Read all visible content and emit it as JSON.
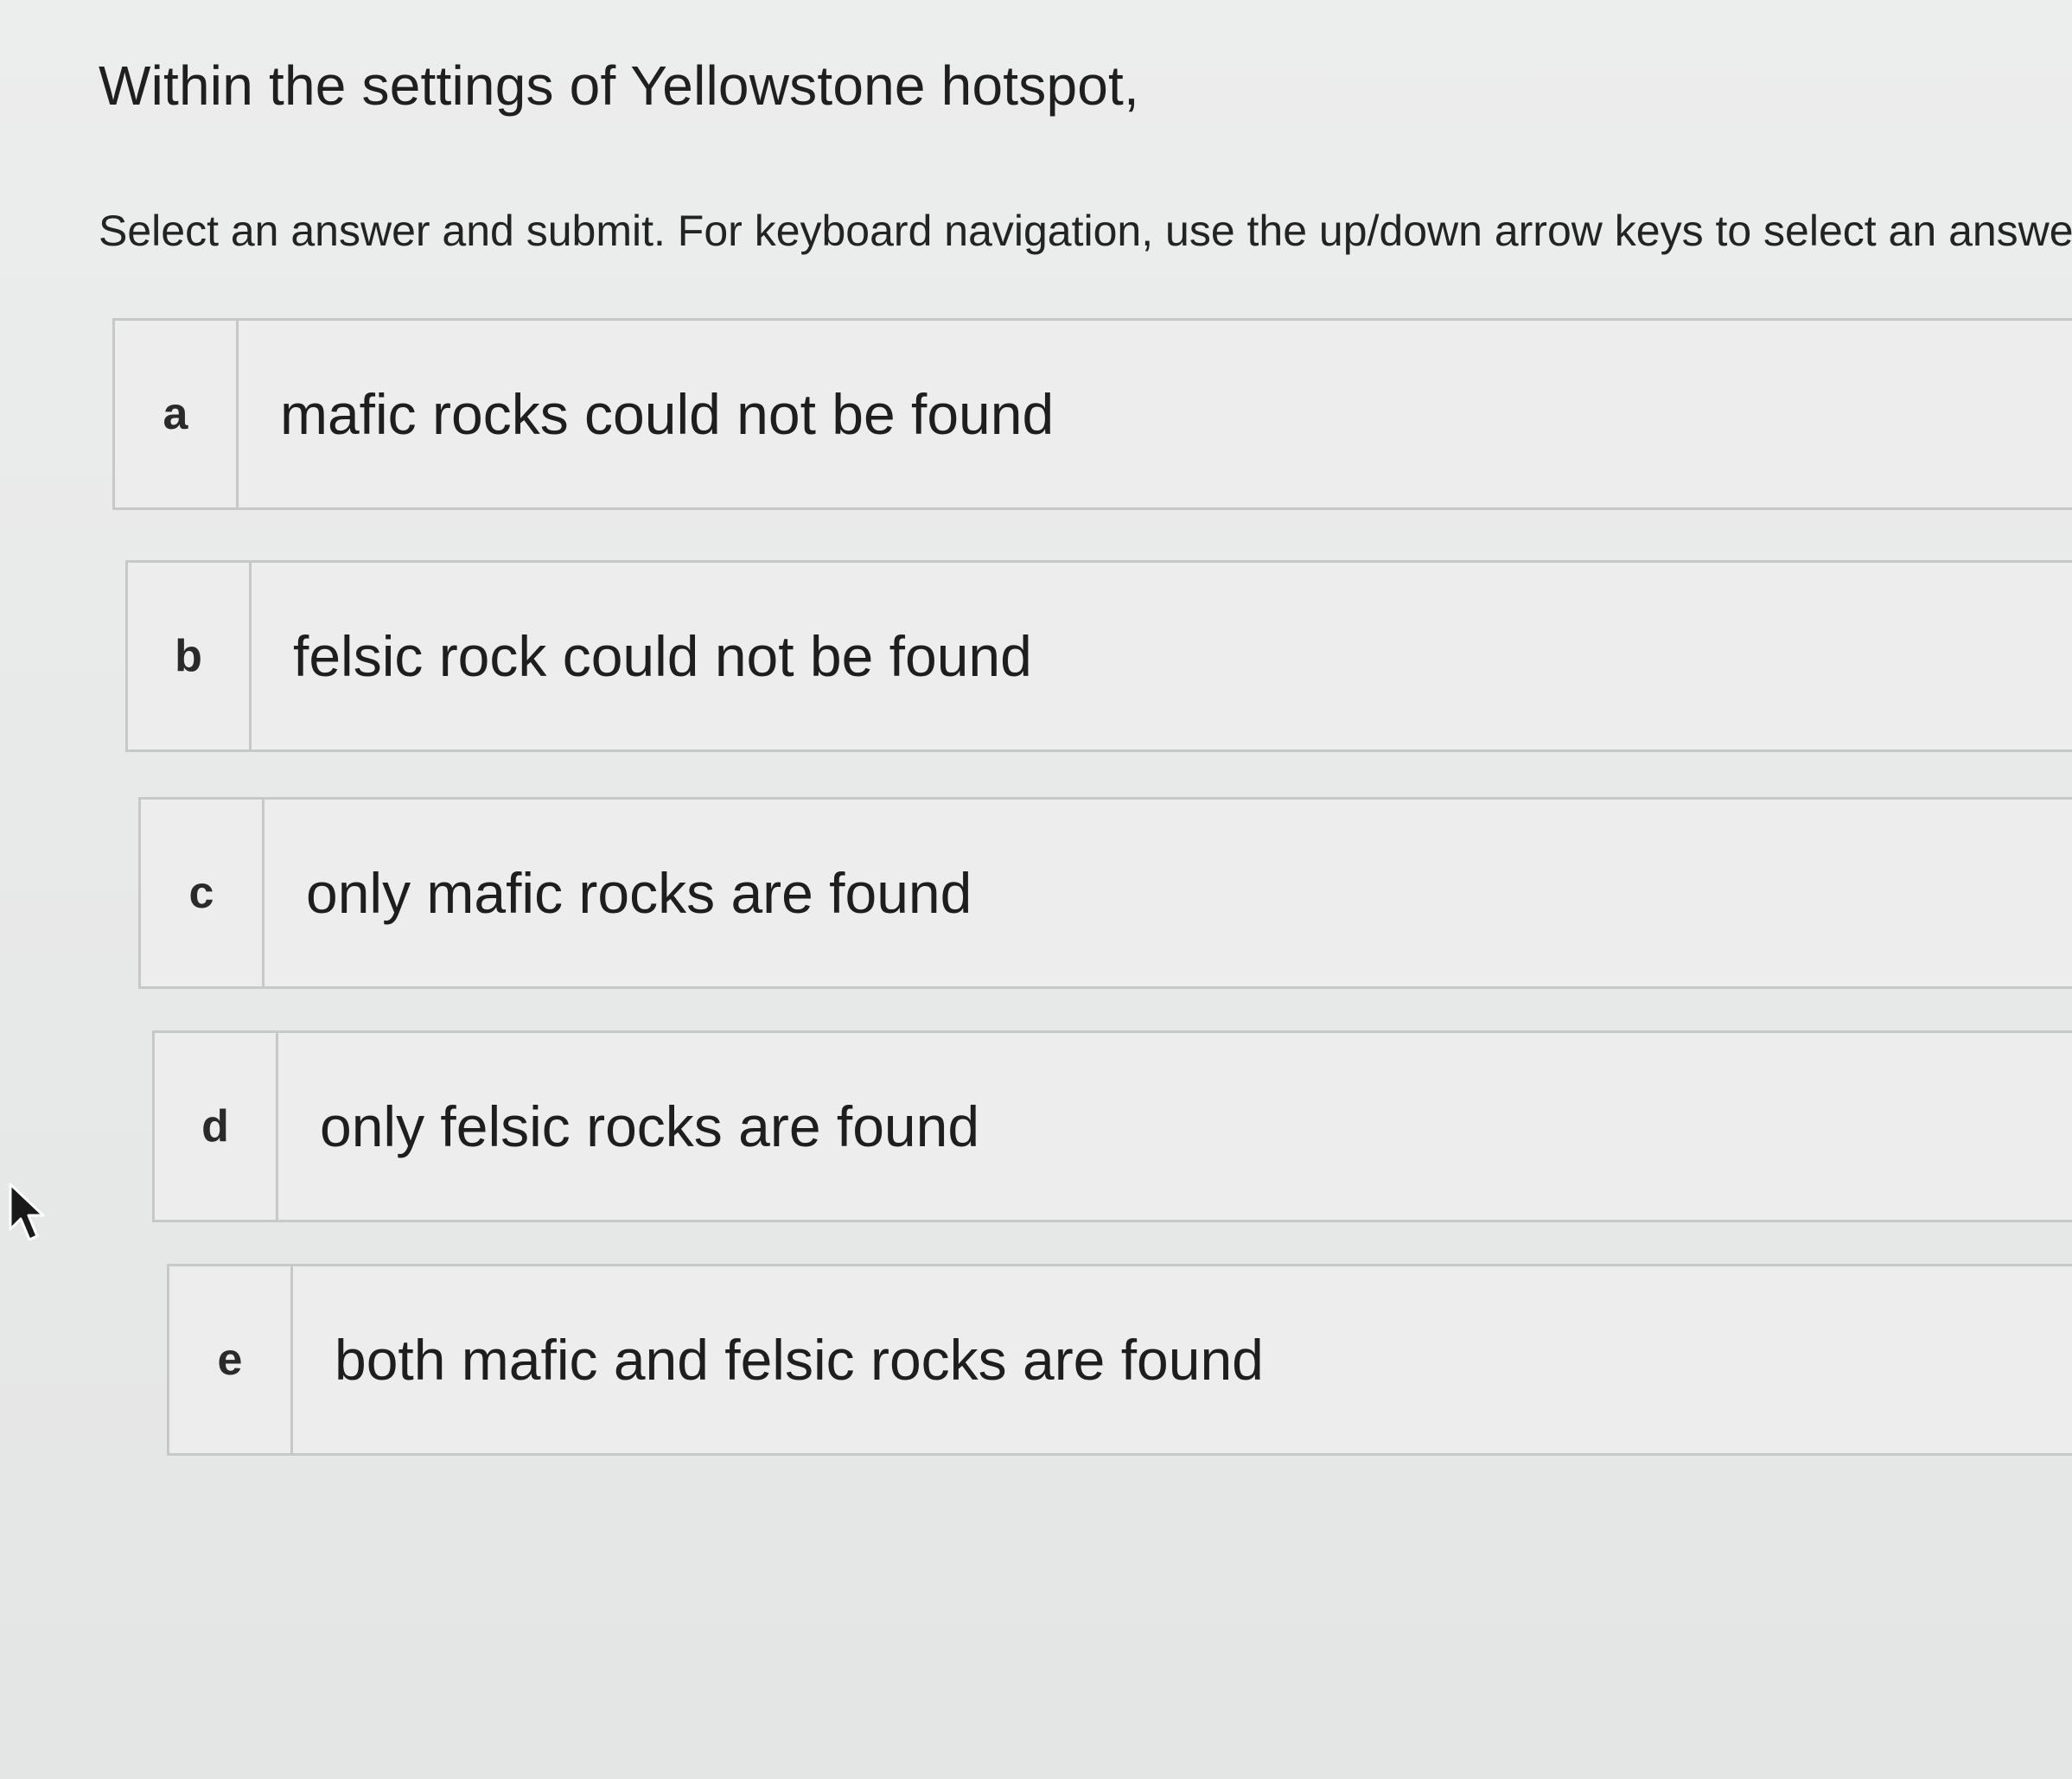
{
  "question": {
    "text": "Within the settings of Yellowstone hotspot,"
  },
  "instructions": {
    "text": "Select an answer and submit. For keyboard navigation, use the up/down arrow keys to select an answer."
  },
  "options": [
    {
      "letter": "a",
      "text": "mafic rocks could not be found"
    },
    {
      "letter": "b",
      "text": "felsic rock could not be found"
    },
    {
      "letter": "c",
      "text": "only mafic rocks are found"
    },
    {
      "letter": "d",
      "text": "only felsic rocks are found"
    },
    {
      "letter": "e",
      "text": "both mafic and felsic rocks are found"
    }
  ],
  "icons": {
    "cursor": "mouse-pointer-icon"
  }
}
